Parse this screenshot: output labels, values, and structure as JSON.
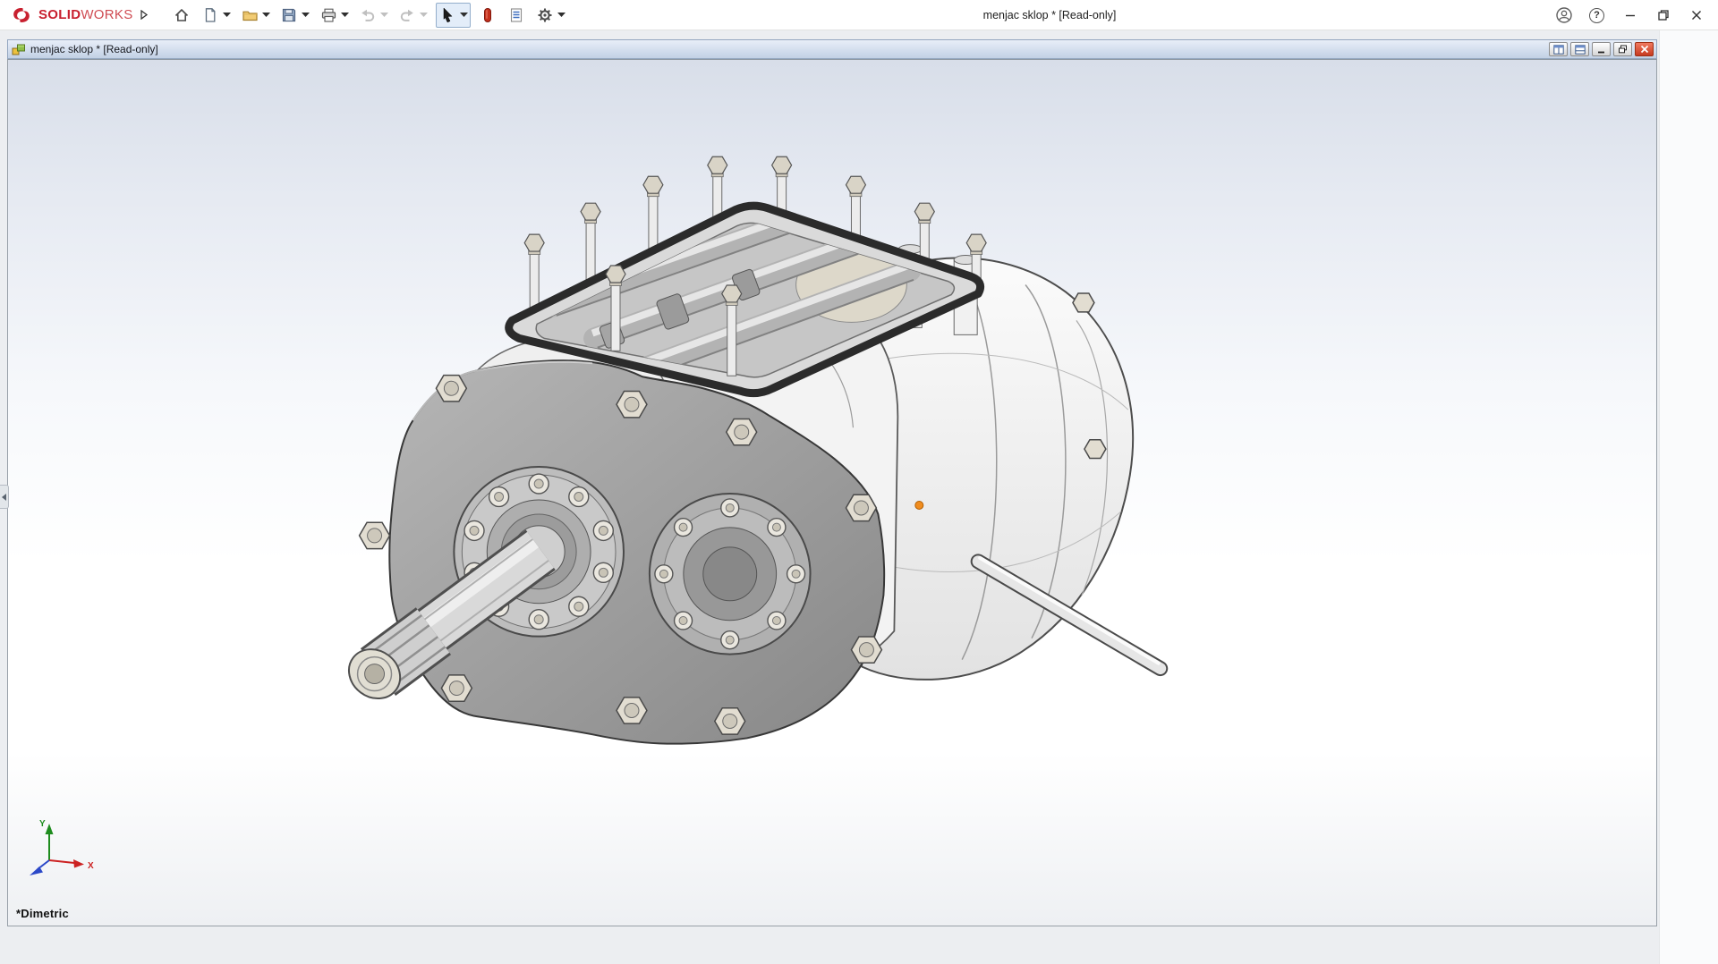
{
  "brand": {
    "solid": "SOLID",
    "works": "WORKS"
  },
  "app": {
    "title": "menjac sklop * [Read-only]"
  },
  "icons": {
    "help_glyph": "?"
  },
  "document_window": {
    "title": "menjac sklop * [Read-only]"
  },
  "viewport": {
    "view_orientation_label": "*Dimetric",
    "triad": {
      "y_label": "Y",
      "x_label": "X"
    }
  },
  "colors": {
    "brand_red": "#c8202f",
    "doc_titlebar_top": "#e8eef8",
    "doc_titlebar_bottom": "#c2d1e5",
    "close_button_red": "#c63a20",
    "viewport_top": "#d8dee9",
    "viewport_bottom": "#eef0f3",
    "origin_marker_orange": "#f08c1e"
  }
}
